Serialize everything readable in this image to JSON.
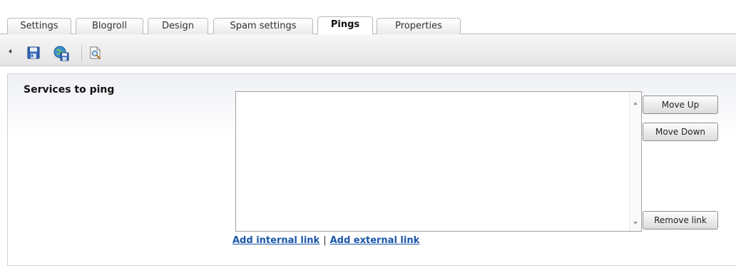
{
  "tabs": [
    {
      "label": "Settings",
      "active": false
    },
    {
      "label": "Blogroll",
      "active": false
    },
    {
      "label": "Design",
      "active": false
    },
    {
      "label": "Spam settings",
      "active": false
    },
    {
      "label": "Pings",
      "active": true
    },
    {
      "label": "Properties",
      "active": false
    }
  ],
  "toolbar": {
    "icons": [
      "collapse-arrow-icon",
      "save-icon",
      "save-and-publish-icon",
      "preview-icon"
    ]
  },
  "services": {
    "label": "Services to ping",
    "items": [],
    "buttons": {
      "move_up": "Move Up",
      "move_down": "Move Down",
      "remove": "Remove link"
    },
    "links": {
      "add_internal": "Add internal link",
      "separator": "|",
      "add_external": "Add external link"
    }
  },
  "colors": {
    "link": "#1a56a8",
    "border": "#b8b8b8",
    "toolbar_bg": "#e4e4e4"
  }
}
